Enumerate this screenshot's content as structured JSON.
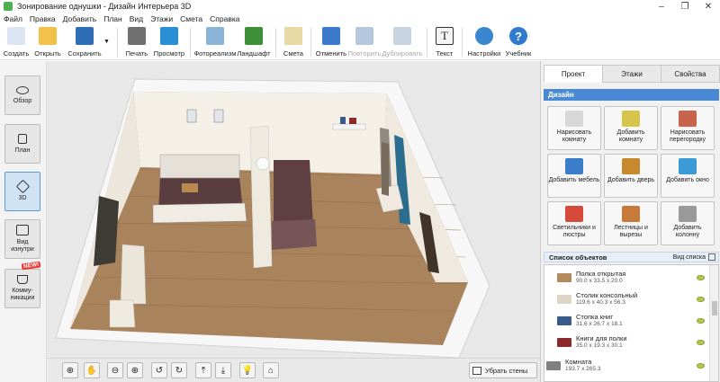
{
  "window": {
    "title": "Зонирование однушки - Дизайн Интерьера 3D",
    "min": "–",
    "max": "❐",
    "close": "✕"
  },
  "menu": [
    "Файл",
    "Правка",
    "Добавить",
    "План",
    "Вид",
    "Этажи",
    "Смета",
    "Справка"
  ],
  "toolbar": [
    {
      "label": "Создать",
      "icon": "new-file-icon",
      "color": "#dbe6f2"
    },
    {
      "label": "Открыть",
      "icon": "open-folder-icon",
      "color": "#f1c14a"
    },
    {
      "label": "Сохранить",
      "icon": "save-floppy-icon",
      "color": "#2f6db5"
    },
    {
      "label": "Печать",
      "icon": "printer-icon",
      "color": "#707070"
    },
    {
      "label": "Просмотр",
      "icon": "monitor-icon",
      "color": "#2b8fd6"
    },
    {
      "label": "Фотореализм",
      "icon": "photo-icon",
      "color": "#8bb4d9"
    },
    {
      "label": "Ландшафт",
      "icon": "tree-icon",
      "color": "#3f8f3a"
    },
    {
      "label": "Смета",
      "icon": "estimate-icon",
      "color": "#e9d9a6"
    },
    {
      "label": "Отменить",
      "icon": "undo-icon",
      "color": "#3c7bc9"
    },
    {
      "label": "Повторить",
      "icon": "redo-icon",
      "color": "#b6c8de",
      "disabled": true
    },
    {
      "label": "Дублировать",
      "icon": "duplicate-icon",
      "color": "#c9d4e2",
      "disabled": true
    },
    {
      "label": "Текст",
      "icon": "text-icon",
      "color": "#f4f4f4"
    },
    {
      "label": "Настройки",
      "icon": "gear-icon",
      "color": "#3a86cf"
    },
    {
      "label": "Учебник",
      "icon": "help-icon",
      "color": "#2f7bd0"
    }
  ],
  "views": [
    {
      "label": "Обзор",
      "icon": "eye-icon"
    },
    {
      "label": "План",
      "icon": "plan-icon"
    },
    {
      "label": "3D",
      "icon": "cube-3d-icon",
      "active": true
    },
    {
      "label": "Вид изнутри",
      "icon": "inside-view-icon"
    },
    {
      "label": "Комму-никации",
      "icon": "faucet-icon"
    }
  ],
  "new_badge": "NEW!",
  "viewport": {
    "floor_color": "#a8835c",
    "wall_color": "#f4efe7",
    "rim_color": "#f7f7f7",
    "bottom_buttons": [
      "reset-view-icon",
      "hand-pan-icon",
      "zoom-out-icon",
      "zoom-in-icon",
      "rotate-left-icon",
      "rotate-right-icon",
      "tilt-up-icon",
      "tilt-down-icon",
      "light-bulb-icon",
      "home-icon"
    ],
    "bottom_glyphs": [
      "⊕",
      "✋",
      "⊖",
      "⊕",
      "↺",
      "↻",
      "⤒",
      "⤓",
      "💡",
      "⌂"
    ],
    "hide_walls": "Убрать стены"
  },
  "right": {
    "tabs": [
      "Проект",
      "Этажи",
      "Свойства"
    ],
    "design_header": "Дизайн",
    "actions": [
      {
        "label": "Нарисовать комнату",
        "icon": "draw-room-icon",
        "color": "#d8d8d8"
      },
      {
        "label": "Добавить комнату",
        "icon": "add-room-icon",
        "color": "#d7c44a"
      },
      {
        "label": "Нарисовать перегородку",
        "icon": "draw-wall-icon",
        "color": "#c8644c"
      },
      {
        "label": "Добавить мебель",
        "icon": "chair-icon",
        "color": "#3b7dc8"
      },
      {
        "label": "Добавить дверь",
        "icon": "door-icon",
        "color": "#c8882e"
      },
      {
        "label": "Добавить окно",
        "icon": "window-icon",
        "color": "#3c9bd6"
      },
      {
        "label": "Светильники и люстры",
        "icon": "lamp-icon",
        "color": "#d64a3a"
      },
      {
        "label": "Лестницы и вырезы",
        "icon": "stairs-icon",
        "color": "#c87a3a"
      },
      {
        "label": "Добавить колонну",
        "icon": "column-icon",
        "color": "#9a9a9a"
      }
    ],
    "objects_header": "Список объектов",
    "view_list": "Вид списка",
    "objects": [
      {
        "name": "Полка открытая",
        "size": "90.0 x 33.5 x 20.0",
        "icon": "shelf-icon",
        "color": "#b58a5a"
      },
      {
        "name": "Столик консольный",
        "size": "119.6 x 40.3 x 56.3",
        "icon": "console-table-icon",
        "color": "#ddd6c6"
      },
      {
        "name": "Стопка книг",
        "size": "31.6 x 26.7 x 18.1",
        "icon": "books-icon",
        "color": "#3a5a8a"
      },
      {
        "name": "Книги для полки",
        "size": "35.0 x 19.3 x 30.1",
        "icon": "books-shelf-icon",
        "color": "#8a2a2a"
      },
      {
        "name": "Комната",
        "size": "193.7 x 265.3",
        "icon": "room-icon",
        "color": "#808080"
      }
    ]
  }
}
